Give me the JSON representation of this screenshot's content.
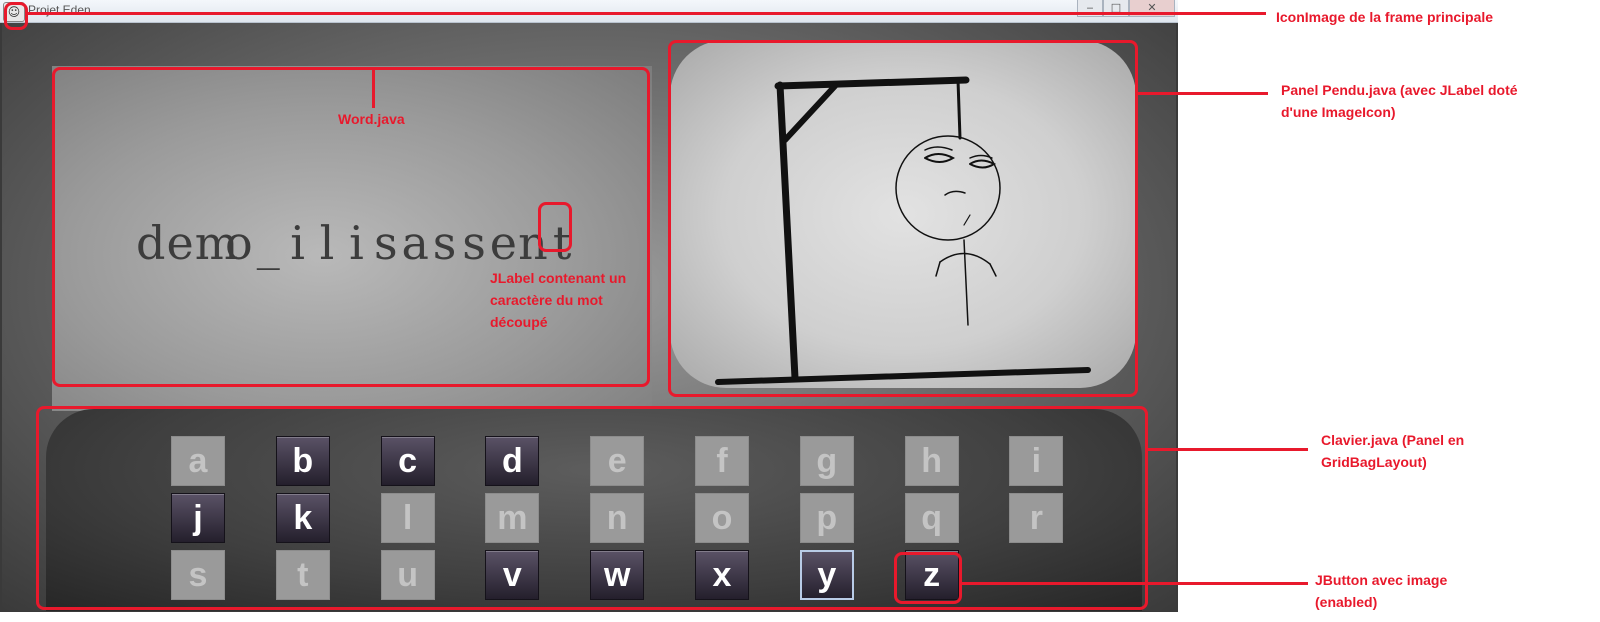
{
  "window": {
    "title": "Projet Eden",
    "icon": "hangman-app-icon",
    "controls": {
      "minimize": "‒",
      "maximize": "□",
      "close": "✕"
    }
  },
  "word": {
    "characters": [
      "d",
      "e",
      "m",
      "o",
      "_",
      "i",
      "l",
      "i",
      "s",
      "a",
      "s",
      "s",
      "e",
      "n",
      "t"
    ]
  },
  "keyboard": {
    "keys": [
      {
        "letter": "a",
        "enabled": false
      },
      {
        "letter": "b",
        "enabled": true
      },
      {
        "letter": "c",
        "enabled": true
      },
      {
        "letter": "d",
        "enabled": true
      },
      {
        "letter": "e",
        "enabled": false
      },
      {
        "letter": "f",
        "enabled": false
      },
      {
        "letter": "g",
        "enabled": false
      },
      {
        "letter": "h",
        "enabled": false
      },
      {
        "letter": "i",
        "enabled": false
      },
      {
        "letter": "j",
        "enabled": true
      },
      {
        "letter": "k",
        "enabled": true
      },
      {
        "letter": "l",
        "enabled": false
      },
      {
        "letter": "m",
        "enabled": false
      },
      {
        "letter": "n",
        "enabled": false
      },
      {
        "letter": "o",
        "enabled": false
      },
      {
        "letter": "p",
        "enabled": false
      },
      {
        "letter": "q",
        "enabled": false
      },
      {
        "letter": "r",
        "enabled": false
      },
      {
        "letter": "s",
        "enabled": false
      },
      {
        "letter": "t",
        "enabled": false
      },
      {
        "letter": "u",
        "enabled": false
      },
      {
        "letter": "v",
        "enabled": true
      },
      {
        "letter": "w",
        "enabled": true
      },
      {
        "letter": "x",
        "enabled": true
      },
      {
        "letter": "y",
        "enabled": true,
        "focused": true
      },
      {
        "letter": "z",
        "enabled": true
      }
    ]
  },
  "annotations": {
    "iconimage": "IconImage de la frame principale",
    "word_panel": "Word.java",
    "pendu_line1": "Panel Pendu.java (avec JLabel doté",
    "pendu_line2": "d'une ImageIcon)",
    "jlabel_line1": "JLabel contenant un",
    "jlabel_line2": "caractère du mot",
    "jlabel_line3": "découpé",
    "clavier_line1": "Clavier.java (Panel en",
    "clavier_line2": "GridBagLayout)",
    "jbutton_line1": "JButton avec image",
    "jbutton_line2": "(enabled)"
  },
  "colors": {
    "annotation": "#e8192c",
    "key_enabled": "#3a3344",
    "key_disabled": "#9a9a9a"
  }
}
